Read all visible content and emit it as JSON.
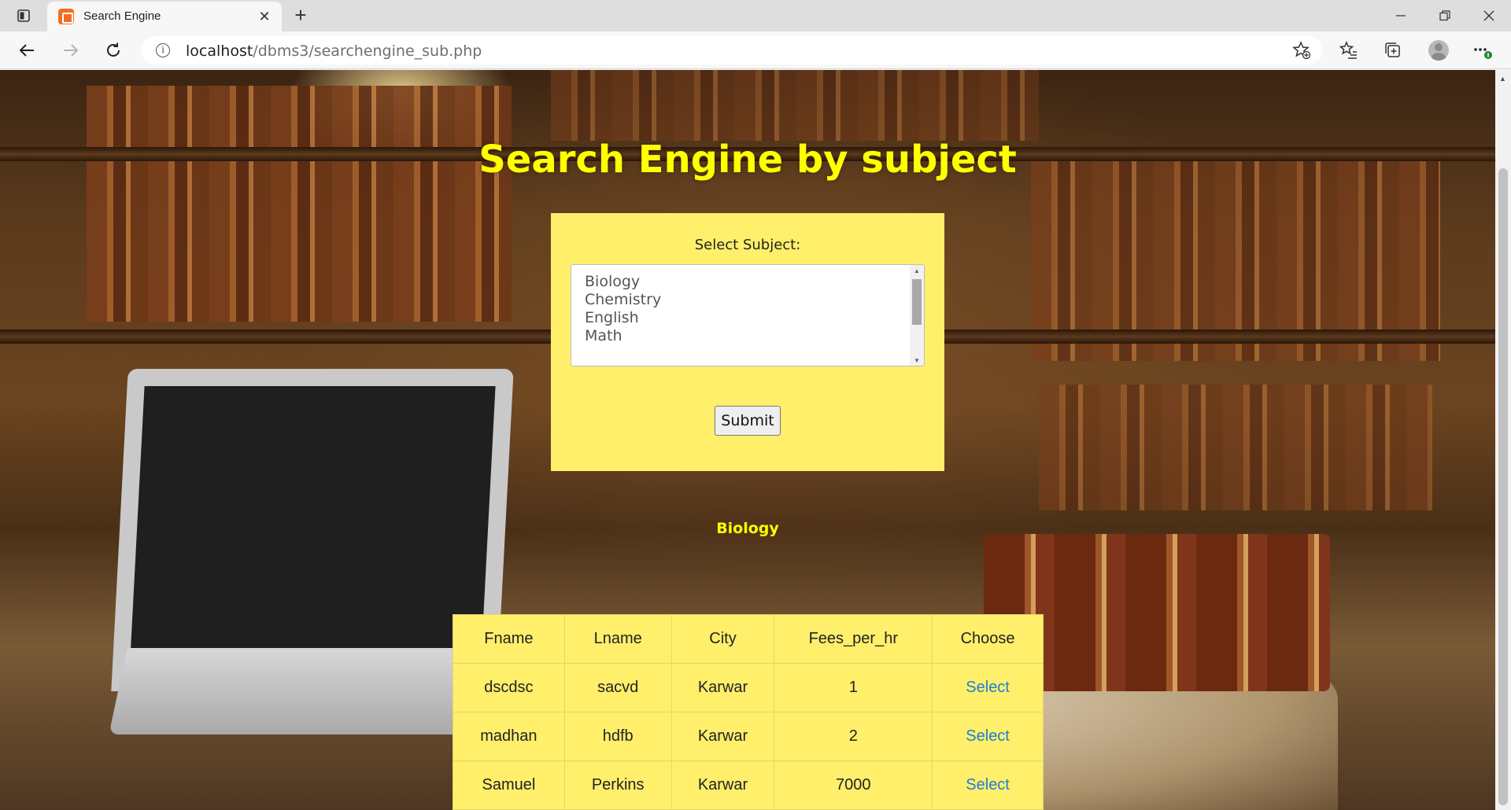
{
  "browser": {
    "tab_title": "Search Engine",
    "url_host": "localhost",
    "url_path": "/dbms3/searchengine_sub.php",
    "icons": [
      "tab-actions-icon",
      "close-icon",
      "plus-icon",
      "minimize-icon",
      "restore-icon",
      "close-window-icon",
      "back-arrow-icon",
      "forward-arrow-icon",
      "refresh-icon",
      "info-icon",
      "favorite-star-icon",
      "favorites-list-icon",
      "collections-icon",
      "profile-avatar",
      "more-menu-icon"
    ]
  },
  "page": {
    "title": "Search Engine by subject",
    "form": {
      "label": "Select Subject:",
      "options": [
        "Biology",
        "Chemistry",
        "English",
        "Math"
      ],
      "submit_label": "Submit"
    },
    "result_subject": "Biology",
    "table": {
      "headers": [
        "Fname",
        "Lname",
        "City",
        "Fees_per_hr",
        "Choose"
      ],
      "rows": [
        {
          "fname": "dscdsc",
          "lname": "sacvd",
          "city": "Karwar",
          "fees": "1",
          "choose": "Select"
        },
        {
          "fname": "madhan",
          "lname": "hdfb",
          "city": "Karwar",
          "fees": "2",
          "choose": "Select"
        },
        {
          "fname": "Samuel",
          "lname": "Perkins",
          "city": "Karwar",
          "fees": "7000",
          "choose": "Select"
        }
      ]
    },
    "colors": {
      "title": "#ffff00",
      "panel": "#ffef6b",
      "link": "#1a7fd8"
    }
  }
}
